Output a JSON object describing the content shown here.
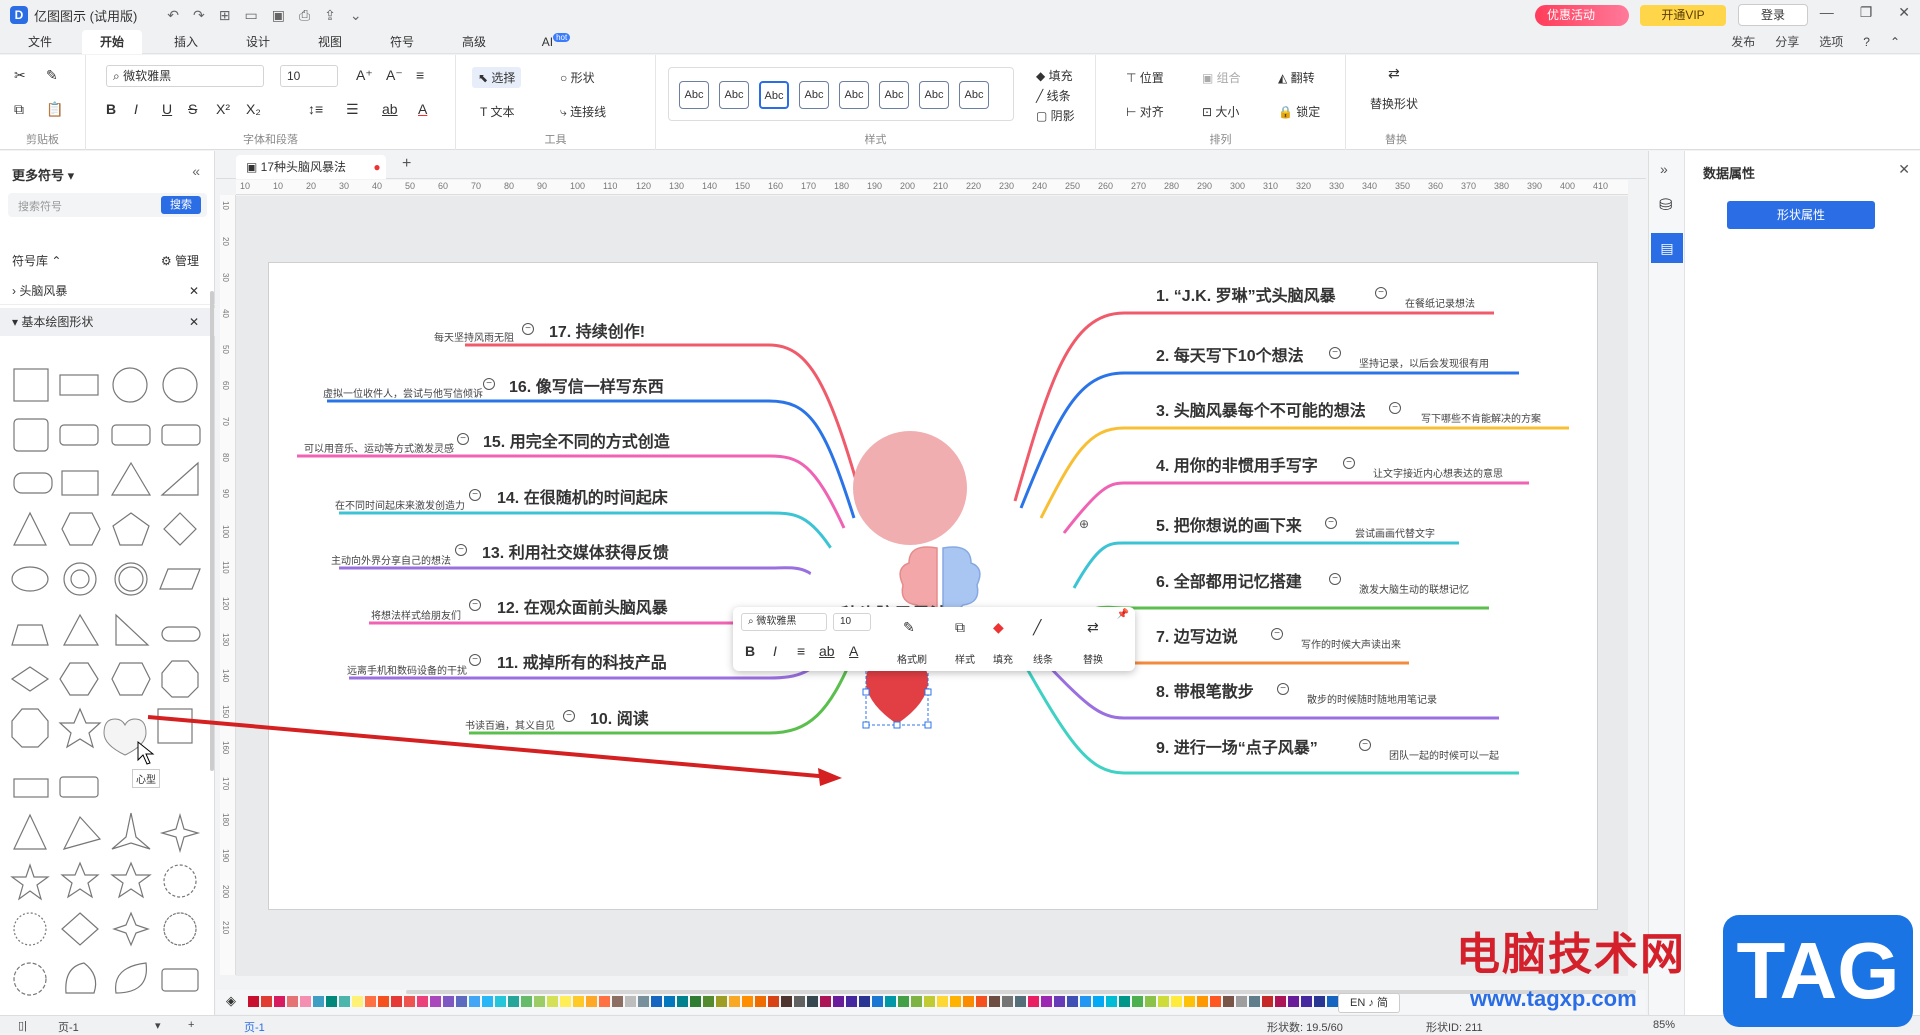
{
  "app": {
    "title": "亿图图示 (试用版)",
    "promo": "优惠活动",
    "vip": "开通VIP",
    "login": "登录"
  },
  "menu": {
    "items": [
      "文件",
      "开始",
      "插入",
      "设计",
      "视图",
      "符号",
      "高级",
      "AI"
    ],
    "hot": "hot",
    "right": [
      "发布",
      "分享",
      "选项"
    ]
  },
  "ribbon": {
    "groups": [
      "剪贴板",
      "字体和段落",
      "工具",
      "样式",
      "排列",
      "替换"
    ],
    "font_family": "微软雅黑",
    "font_size": "10",
    "tools": [
      "选择",
      "形状",
      "文本",
      "连接线"
    ],
    "style_sample": "Abc",
    "style_opts": [
      "填充",
      "线条",
      "阴影"
    ],
    "arrange": [
      "位置",
      "组合",
      "翻转",
      "对齐",
      "大小",
      "锁定"
    ],
    "replace": "替换形状"
  },
  "left": {
    "title": "更多符号",
    "search_placeholder": "搜索符号",
    "search_btn": "搜索",
    "library": "符号库",
    "manage": "管理",
    "cat1": "头脑风暴",
    "cat2": "基本绘图形状",
    "tooltip": "心型"
  },
  "tab": {
    "name": "17种头脑风暴法"
  },
  "ruler": {
    "h": [
      "10",
      "10",
      "20",
      "30",
      "40",
      "50",
      "60",
      "70",
      "80",
      "90",
      "100",
      "110",
      "120",
      "130",
      "140",
      "150",
      "160",
      "170",
      "180",
      "190",
      "200",
      "210",
      "220",
      "230",
      "240",
      "250",
      "260",
      "270",
      "280",
      "290",
      "300",
      "310",
      "320",
      "330",
      "340",
      "350",
      "360",
      "370",
      "380",
      "390",
      "400",
      "410"
    ],
    "v": [
      "10",
      "20",
      "30",
      "40",
      "50",
      "60",
      "70",
      "80",
      "90",
      "100",
      "110",
      "120",
      "130",
      "140",
      "150",
      "160",
      "170",
      "180",
      "190",
      "200",
      "210"
    ]
  },
  "right_panel": {
    "title": "数据属性",
    "button": "形状属性"
  },
  "mindmap": {
    "center_title": "17种头脑风暴法",
    "right": [
      {
        "t": "1. “J.K. 罗琳”式头脑风暴",
        "s": "在餐纸记录想法"
      },
      {
        "t": "2. 每天写下10个想法",
        "s": "坚持记录，以后会发现很有用"
      },
      {
        "t": "3. 头脑风暴每个不可能的想法",
        "s": "写下哪些不肯能解决的方案"
      },
      {
        "t": "4. 用你的非惯用手写字",
        "s": "让文字接近内心想表达的意思"
      },
      {
        "t": "5. 把你想说的画下来",
        "s": "尝试画画代替文字"
      },
      {
        "t": "6. 全部都用记忆搭建",
        "s": "激发大脑生动的联想记忆"
      },
      {
        "t": "7. 边写边说",
        "s": "写作的时候大声读出来"
      },
      {
        "t": "8. 带根笔散步",
        "s": "散步的时候随时随地用笔记录"
      },
      {
        "t": "9. 进行一场“点子风暴”",
        "s": "团队一起的时候可以一起"
      }
    ],
    "left": [
      {
        "t": "17. 持续创作!",
        "s": "每天坚持风雨无阻"
      },
      {
        "t": "16. 像写信一样写东西",
        "s": "虚拟一位收件人，尝试与他写信倾诉"
      },
      {
        "t": "15. 用完全不同的方式创造",
        "s": "可以用音乐、运动等方式激发灵感"
      },
      {
        "t": "14. 在很随机的时间起床",
        "s": "在不同时间起床来激发创造力"
      },
      {
        "t": "13. 利用社交媒体获得反馈",
        "s": "主动向外界分享自己的想法"
      },
      {
        "t": "12. 在观众面前头脑风暴",
        "s": "将想法样式给朋友们"
      },
      {
        "t": "11. 戒掉所有的科技产品",
        "s": "远离手机和数码设备的干扰"
      },
      {
        "t": "10. 阅读",
        "s": "书读百遍，其义自见"
      }
    ]
  },
  "floatbar": {
    "font": "微软雅黑",
    "size": "10",
    "labels": [
      "格式刷",
      "样式",
      "填充",
      "线条",
      "替换"
    ]
  },
  "status": {
    "page": "页-1",
    "page_tab": "页-1",
    "shapes": "形状数: 19.5/60",
    "shape_id": "形状ID: 211",
    "zoom": "85%",
    "ime": "EN ♪ 简"
  },
  "watermark": {
    "cn": "电脑技术网",
    "url": "www.tagxp.com",
    "tag": "TAG"
  }
}
